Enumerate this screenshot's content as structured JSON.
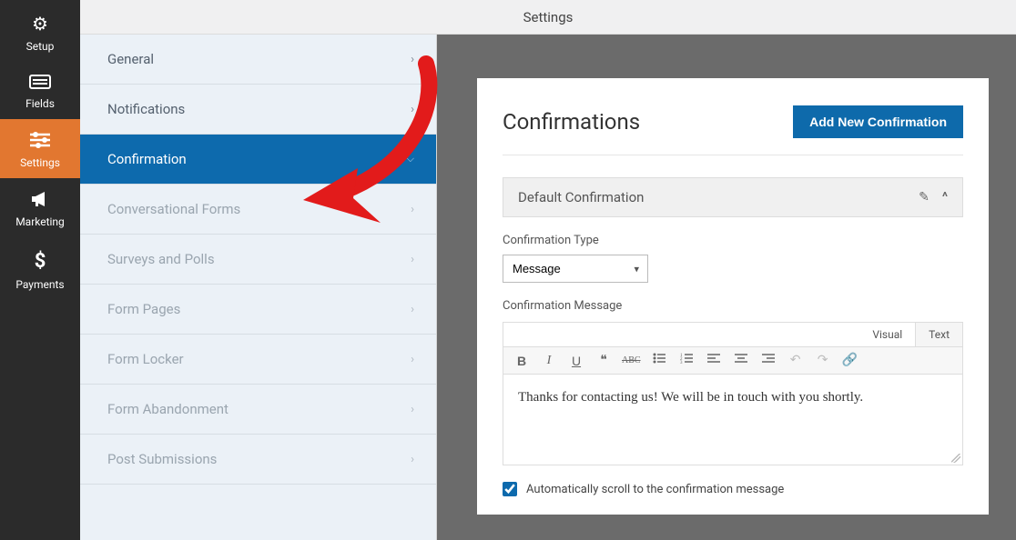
{
  "header": {
    "title": "Settings"
  },
  "sidebar": {
    "items": [
      {
        "label": "Setup",
        "icon": "gear-icon"
      },
      {
        "label": "Fields",
        "icon": "list-icon"
      },
      {
        "label": "Settings",
        "icon": "sliders-icon",
        "active": true
      },
      {
        "label": "Marketing",
        "icon": "megaphone-icon"
      },
      {
        "label": "Payments",
        "icon": "dollar-icon"
      }
    ]
  },
  "settingsMenu": {
    "items": [
      {
        "label": "General",
        "chev": "›"
      },
      {
        "label": "Notifications",
        "chev": "›"
      },
      {
        "label": "Confirmation",
        "chev": "⌄",
        "active": true
      },
      {
        "label": "Conversational Forms",
        "chev": "›",
        "muted": true
      },
      {
        "label": "Surveys and Polls",
        "chev": "›",
        "muted": true
      },
      {
        "label": "Form Pages",
        "chev": "›",
        "muted": true
      },
      {
        "label": "Form Locker",
        "chev": "›",
        "muted": true
      },
      {
        "label": "Form Abandonment",
        "chev": "›",
        "muted": true
      },
      {
        "label": "Post Submissions",
        "chev": "›",
        "muted": true
      }
    ]
  },
  "confirmations": {
    "title": "Confirmations",
    "addBtn": "Add New Confirmation",
    "defaultTitle": "Default Confirmation",
    "typeLabel": "Confirmation Type",
    "typeValue": "Message",
    "messageLabel": "Confirmation Message",
    "tabs": {
      "visual": "Visual",
      "text": "Text"
    },
    "messageBody": "Thanks for contacting us! We will be in touch with you shortly.",
    "autoscrollLabel": "Automatically scroll to the confirmation message",
    "autoscrollChecked": true
  },
  "colors": {
    "accent": "#e27730",
    "primary": "#0d6aad"
  }
}
